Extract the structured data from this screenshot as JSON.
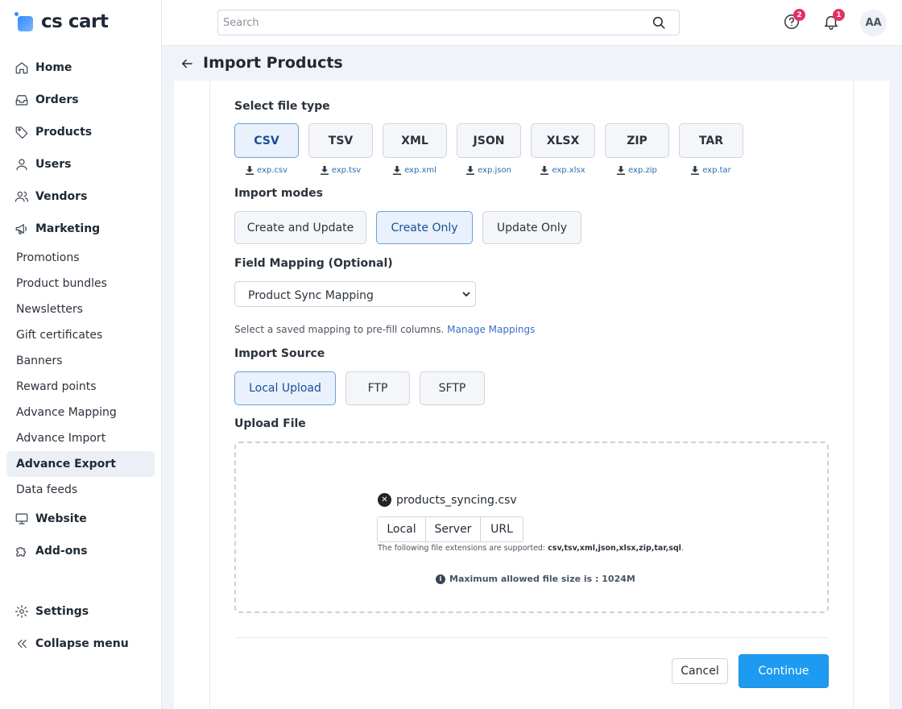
{
  "app": {
    "logo_text": "cs cart"
  },
  "header": {
    "search_placeholder": "Search",
    "help_badge": "2",
    "notif_badge": "1",
    "avatar_initials": "AA"
  },
  "sidebar": {
    "main_items": [
      {
        "label": "Home",
        "icon": "home-icon"
      },
      {
        "label": "Orders",
        "icon": "inbox-icon"
      },
      {
        "label": "Products",
        "icon": "tag-icon"
      },
      {
        "label": "Users",
        "icon": "user-icon"
      },
      {
        "label": "Vendors",
        "icon": "users-icon"
      },
      {
        "label": "Marketing",
        "icon": "megaphone-icon"
      }
    ],
    "marketing_sub": [
      "Promotions",
      "Product bundles",
      "Newsletters",
      "Gift certificates",
      "Banners",
      "Reward points",
      "Advance Mapping",
      "Advance Import",
      "Advance Export",
      "Data feeds"
    ],
    "active_sub": "Advance Export",
    "lower_items": [
      {
        "label": "Website",
        "icon": "monitor-icon"
      },
      {
        "label": "Add-ons",
        "icon": "puzzle-icon"
      }
    ],
    "settings_label": "Settings",
    "collapse_label": "Collapse menu"
  },
  "page": {
    "title": "Import Products"
  },
  "file_type": {
    "label": "Select file type",
    "options": [
      "CSV",
      "TSV",
      "XML",
      "JSON",
      "XLSX",
      "ZIP",
      "TAR"
    ],
    "selected": "CSV",
    "downloads": [
      "exp.csv",
      "exp.tsv",
      "exp.xml",
      "exp.json",
      "exp.xlsx",
      "exp.zip",
      "exp.tar"
    ]
  },
  "import_modes": {
    "label": "Import modes",
    "options": [
      "Create and Update",
      "Create Only",
      "Update Only"
    ],
    "selected": "Create Only"
  },
  "field_mapping": {
    "label": "Field Mapping (Optional)",
    "selected_value": "Product Sync Mapping",
    "help_text": "Select a saved mapping to pre-fill columns.",
    "help_link": "Manage Mappings"
  },
  "import_source": {
    "label": "Import Source",
    "options": [
      "Local Upload",
      "FTP",
      "SFTP"
    ],
    "selected": "Local Upload"
  },
  "upload": {
    "label": "Upload File",
    "file_name": "products_syncing.csv",
    "source_options": [
      "Local",
      "Server",
      "URL"
    ],
    "ext_prefix": "The following file extensions are supported:",
    "ext_list": "csv,tsv,xml,json,xlsx,zip,tar,sql",
    "max_size": "Maximum allowed file size is : 1024M"
  },
  "actions": {
    "cancel": "Cancel",
    "continue": "Continue"
  }
}
